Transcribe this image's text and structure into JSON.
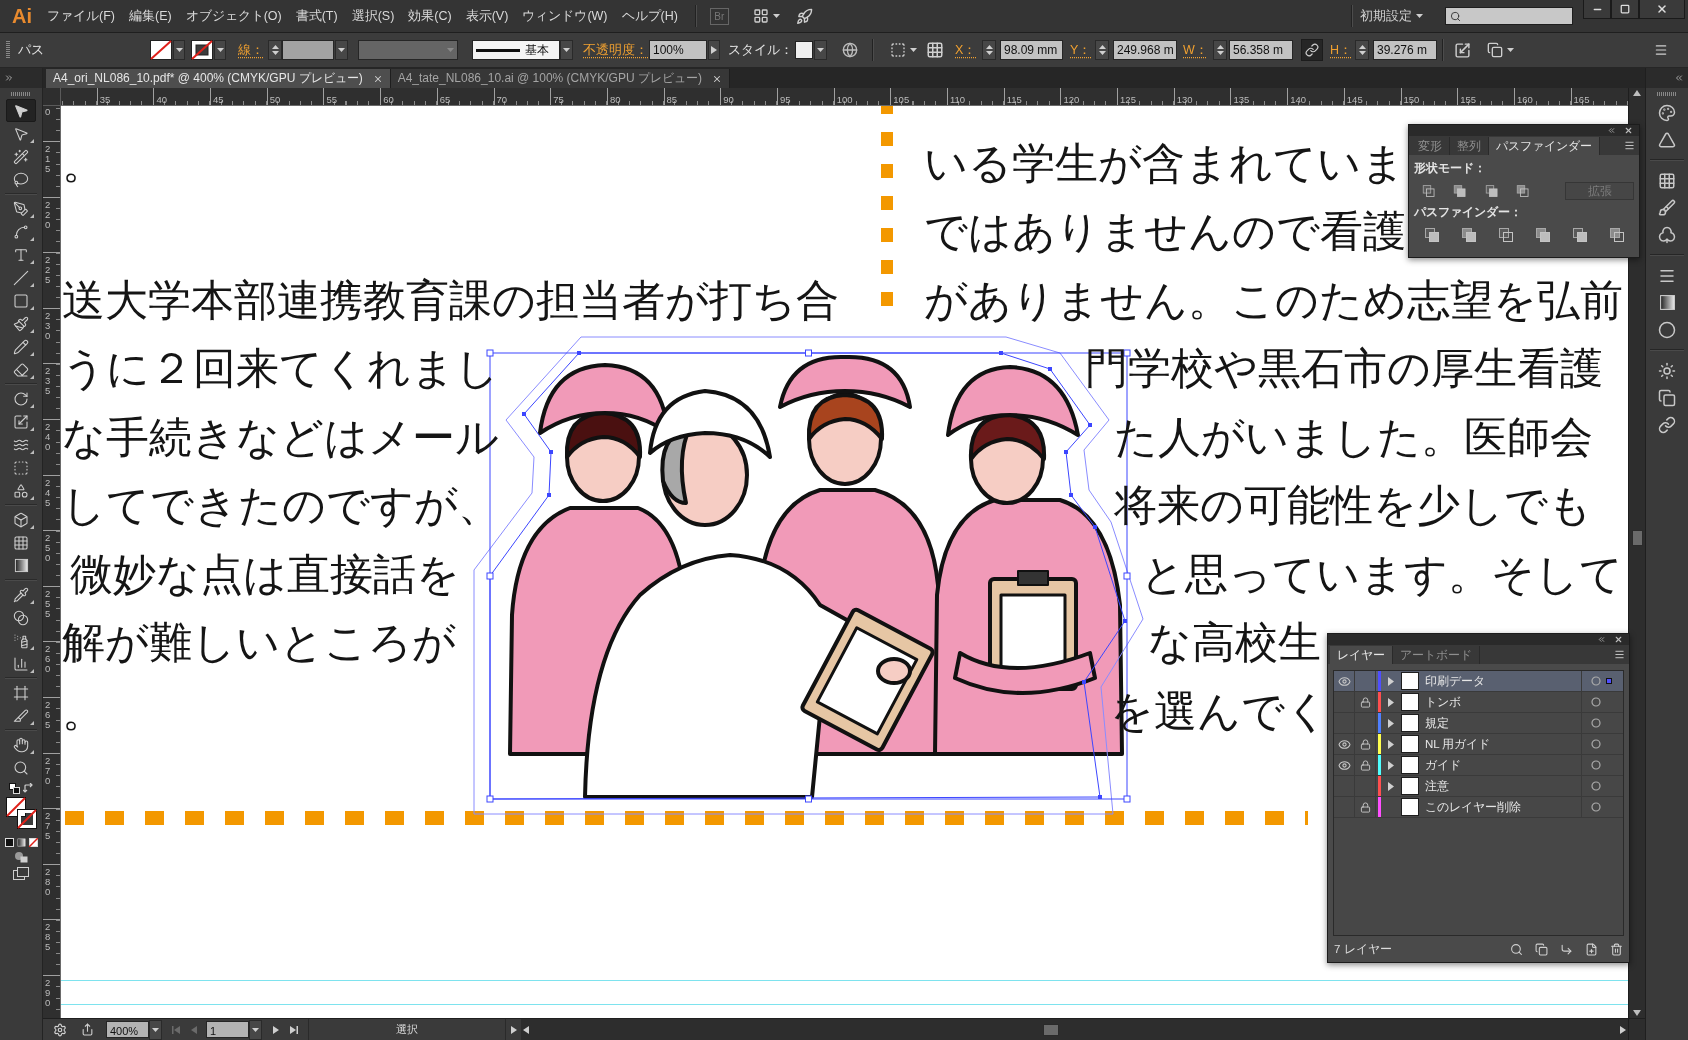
{
  "menu_bar": {
    "logo": "Ai",
    "items": [
      "ファイル(F)",
      "編集(E)",
      "オブジェクト(O)",
      "書式(T)",
      "選択(S)",
      "効果(C)",
      "表示(V)",
      "ウィンドウ(W)",
      "ヘルプ(H)"
    ],
    "bridge": "Br",
    "workspace": "初期設定"
  },
  "control_bar": {
    "selection": "パス",
    "stroke_label": "線：",
    "brush": "基本",
    "opacity_label": "不透明度：",
    "opacity": "100%",
    "style_label": "スタイル：",
    "x_label": "X：",
    "x": "98.09 mm",
    "y_label": "Y：",
    "y": "249.968 m",
    "w_label": "W：",
    "w": "56.358 m",
    "h_label": "H：",
    "h": "39.276 m",
    "constrain_proportions": true
  },
  "document_tabs": [
    {
      "title": "A4_ori_NL086_10.pdf* @ 400% (CMYK/GPU プレビュー)",
      "selected": true
    },
    {
      "title": "A4_tate_NL086_10.ai @ 100% (CMYK/GPU プレビュー)",
      "selected": false
    }
  ],
  "toolbar": {
    "tools": [
      {
        "kind": "selection",
        "selected": true
      },
      {
        "kind": "direct-selection",
        "selected": false
      },
      {
        "kind": "magic-wand",
        "selected": false
      },
      {
        "kind": "lasso",
        "selected": false
      },
      {
        "kind": "pen",
        "selected": false
      },
      {
        "kind": "curvature",
        "selected": false
      },
      {
        "kind": "type",
        "selected": false
      },
      {
        "kind": "line",
        "selected": false
      },
      {
        "kind": "rectangle",
        "selected": false
      },
      {
        "kind": "paintbrush",
        "selected": false
      },
      {
        "kind": "pencil",
        "selected": false
      },
      {
        "kind": "eraser",
        "selected": false
      },
      {
        "kind": "rotate",
        "selected": false
      },
      {
        "kind": "scale",
        "selected": false
      },
      {
        "kind": "warp",
        "selected": false
      },
      {
        "kind": "free-transform",
        "selected": false
      },
      {
        "kind": "shape-builder",
        "selected": false
      },
      {
        "kind": "perspective-grid",
        "selected": false
      },
      {
        "kind": "mesh",
        "selected": false
      },
      {
        "kind": "gradient",
        "selected": false
      },
      {
        "kind": "eyedropper",
        "selected": false
      },
      {
        "kind": "blend",
        "selected": false
      },
      {
        "kind": "symbol-sprayer",
        "selected": false
      },
      {
        "kind": "column-graph",
        "selected": false
      },
      {
        "kind": "artboard",
        "selected": false
      },
      {
        "kind": "slice",
        "selected": false
      },
      {
        "kind": "hand",
        "selected": false
      },
      {
        "kind": "zoom",
        "selected": false
      }
    ]
  },
  "rulers": {
    "horizontal": [
      "35",
      "40",
      "45",
      "50",
      "55",
      "60",
      "65",
      "70",
      "75",
      "80",
      "85",
      "90",
      "95",
      "100",
      "105",
      "110",
      "115",
      "120",
      "125",
      "130",
      "135",
      "140",
      "145",
      "150",
      "155",
      "160",
      "165"
    ],
    "vertical": [
      "0",
      "215",
      "220",
      "225",
      "230",
      "235",
      "240",
      "245",
      "250",
      "255",
      "260",
      "265",
      "270",
      "275",
      "280",
      "285",
      "290"
    ]
  },
  "canvas": {
    "left_column": [
      {
        "lines": [
          "。"
        ]
      },
      {
        "lines": [
          "送大学本部連携教育課の担当者が打ち合",
          "うに２回来てくれまし",
          "な手続きなどはメール",
          "してできたのですが、",
          "微妙な点は直接話を",
          "解が難しいところが",
          "。"
        ]
      }
    ],
    "right_column": [
      "いる学生が含まれていま",
      "ではありませんので看護",
      "がありません。このため志望を弘前",
      "門学校や黒石市の厚生看護",
      "た人がいました。医師会",
      "将来の可能性を少しでも",
      "と思っています。そして",
      "な高校生",
      "を選んでく"
    ]
  },
  "pathfinder_panel": {
    "tabs": [
      {
        "label": "変形",
        "selected": false
      },
      {
        "label": "整列",
        "selected": false
      },
      {
        "label": "パスファインダー",
        "selected": true
      }
    ],
    "shape_modes_label": "形状モード：",
    "expand_button": {
      "label": "拡張",
      "disabled": true
    },
    "pathfinders_label": "パスファインダー："
  },
  "layers_panel": {
    "tabs": [
      {
        "label": "レイヤー",
        "selected": true
      },
      {
        "label": "アートボード",
        "selected": false
      }
    ],
    "layers": [
      {
        "name": "印刷データ",
        "visible": true,
        "locked": false,
        "color": "#4f4fff",
        "expandable": true,
        "selected": true,
        "has_selected_art": true
      },
      {
        "name": "トンボ",
        "visible": false,
        "locked": true,
        "color": "#ff4f4f",
        "expandable": true,
        "selected": false,
        "has_selected_art": false
      },
      {
        "name": "規定",
        "visible": false,
        "locked": false,
        "color": "#4f80ff",
        "expandable": true,
        "selected": false,
        "has_selected_art": false
      },
      {
        "name": "NL 用ガイド",
        "visible": true,
        "locked": true,
        "color": "#ffff4f",
        "expandable": true,
        "selected": false,
        "has_selected_art": false
      },
      {
        "name": "ガイド",
        "visible": true,
        "locked": true,
        "color": "#4fffff",
        "expandable": true,
        "selected": false,
        "has_selected_art": false
      },
      {
        "name": "注意",
        "visible": false,
        "locked": false,
        "color": "#ff4f4f",
        "expandable": true,
        "selected": false,
        "has_selected_art": false
      },
      {
        "name": "このレイヤー削除",
        "visible": false,
        "locked": true,
        "color": "#ff4fff",
        "expandable": false,
        "selected": false,
        "has_selected_art": false
      }
    ],
    "count": "7 レイヤー"
  },
  "status_bar": {
    "zoom": "400%",
    "page": "1",
    "tool": "選択"
  }
}
